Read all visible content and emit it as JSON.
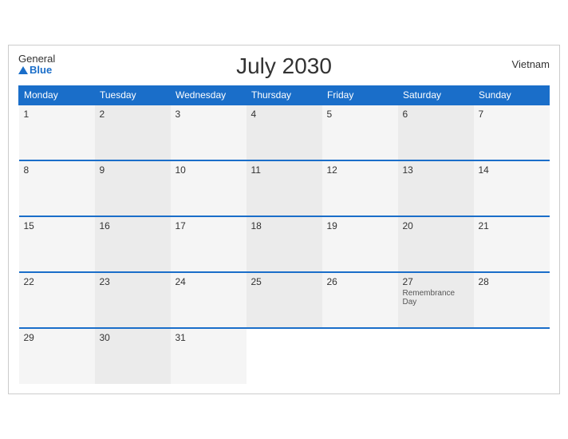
{
  "header": {
    "title": "July 2030",
    "country": "Vietnam",
    "logo_general": "General",
    "logo_blue": "Blue"
  },
  "columns": [
    "Monday",
    "Tuesday",
    "Wednesday",
    "Thursday",
    "Friday",
    "Saturday",
    "Sunday"
  ],
  "weeks": [
    [
      {
        "day": "1",
        "event": ""
      },
      {
        "day": "2",
        "event": ""
      },
      {
        "day": "3",
        "event": ""
      },
      {
        "day": "4",
        "event": ""
      },
      {
        "day": "5",
        "event": ""
      },
      {
        "day": "6",
        "event": ""
      },
      {
        "day": "7",
        "event": ""
      }
    ],
    [
      {
        "day": "8",
        "event": ""
      },
      {
        "day": "9",
        "event": ""
      },
      {
        "day": "10",
        "event": ""
      },
      {
        "day": "11",
        "event": ""
      },
      {
        "day": "12",
        "event": ""
      },
      {
        "day": "13",
        "event": ""
      },
      {
        "day": "14",
        "event": ""
      }
    ],
    [
      {
        "day": "15",
        "event": ""
      },
      {
        "day": "16",
        "event": ""
      },
      {
        "day": "17",
        "event": ""
      },
      {
        "day": "18",
        "event": ""
      },
      {
        "day": "19",
        "event": ""
      },
      {
        "day": "20",
        "event": ""
      },
      {
        "day": "21",
        "event": ""
      }
    ],
    [
      {
        "day": "22",
        "event": ""
      },
      {
        "day": "23",
        "event": ""
      },
      {
        "day": "24",
        "event": ""
      },
      {
        "day": "25",
        "event": ""
      },
      {
        "day": "26",
        "event": ""
      },
      {
        "day": "27",
        "event": "Remembrance Day"
      },
      {
        "day": "28",
        "event": ""
      }
    ],
    [
      {
        "day": "29",
        "event": ""
      },
      {
        "day": "30",
        "event": ""
      },
      {
        "day": "31",
        "event": ""
      },
      {
        "day": "",
        "event": ""
      },
      {
        "day": "",
        "event": ""
      },
      {
        "day": "",
        "event": ""
      },
      {
        "day": "",
        "event": ""
      }
    ]
  ]
}
